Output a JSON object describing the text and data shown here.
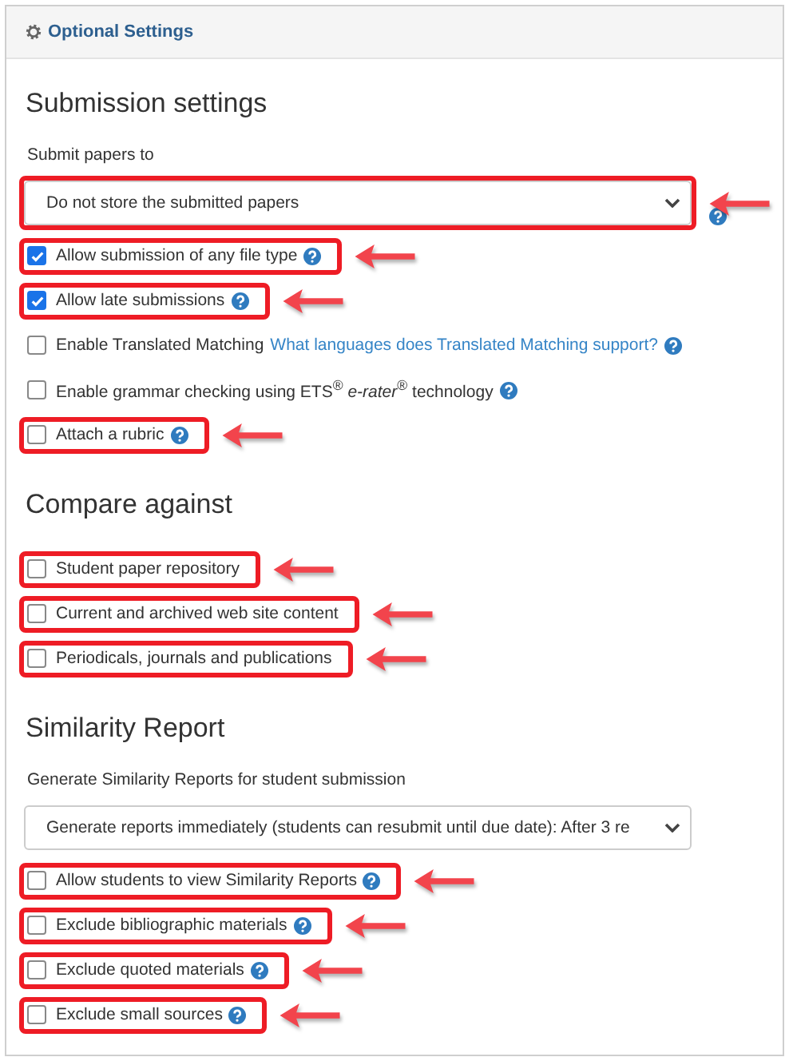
{
  "panel": {
    "title": "Optional Settings"
  },
  "sections": [
    {
      "heading": "Submission settings",
      "items": [
        {
          "kind": "select",
          "label": "Submit papers to",
          "value": "Do not store the submitted papers",
          "help": true,
          "highlighted": true
        },
        {
          "kind": "checkbox",
          "label": "Allow submission of any file type",
          "checked": true,
          "help": true,
          "highlighted": true
        },
        {
          "kind": "checkbox",
          "label": "Allow late submissions",
          "checked": true,
          "help": true,
          "highlighted": true
        },
        {
          "kind": "checkbox",
          "label": "Enable Translated Matching",
          "link": "What languages does Translated Matching support?",
          "checked": false,
          "help": true,
          "highlighted": false
        },
        {
          "kind": "checkbox",
          "label": "Enable grammar checking using ETS$^{®}$ *e-rater*$^{®}$ technology",
          "checked": false,
          "help": true,
          "highlighted": false
        },
        {
          "kind": "checkbox",
          "label": "Attach a rubric",
          "checked": false,
          "help": true,
          "highlighted": true
        }
      ]
    },
    {
      "heading": "Compare against",
      "items": [
        {
          "kind": "checkbox",
          "label": "Student paper repository",
          "checked": false,
          "help": false,
          "highlighted": true
        },
        {
          "kind": "checkbox",
          "label": "Current and archived web site content",
          "checked": false,
          "help": false,
          "highlighted": true
        },
        {
          "kind": "checkbox",
          "label": "Periodicals, journals and publications",
          "checked": false,
          "help": false,
          "highlighted": true
        }
      ]
    },
    {
      "heading": "Similarity Report",
      "items": [
        {
          "kind": "select",
          "label": "Generate Similarity Reports for student submission",
          "value": "Generate reports immediately (students can resubmit until due date): After 3 re",
          "help": false,
          "highlighted": false
        },
        {
          "kind": "checkbox",
          "label": "Allow students to view Similarity Reports",
          "checked": false,
          "help": true,
          "highlighted": true
        },
        {
          "kind": "checkbox",
          "label": "Exclude bibliographic materials",
          "checked": false,
          "help": true,
          "highlighted": true
        },
        {
          "kind": "checkbox",
          "label": "Exclude quoted materials",
          "checked": false,
          "help": true,
          "highlighted": true
        },
        {
          "kind": "checkbox",
          "label": "Exclude small sources",
          "checked": false,
          "help": true,
          "highlighted": true
        }
      ]
    }
  ]
}
